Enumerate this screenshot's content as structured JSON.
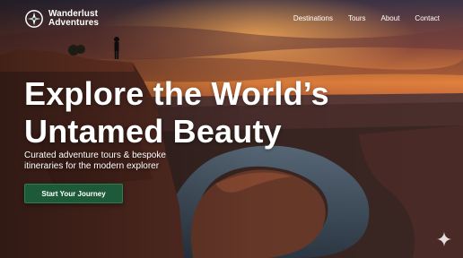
{
  "brand": {
    "line1": "Wanderlust",
    "line2": "Adventures",
    "logo_icon": "compass-icon"
  },
  "nav": {
    "items": [
      "Destinations",
      "Tours",
      "About",
      "Contact"
    ]
  },
  "hero": {
    "headline_line1": "Explore the World’s",
    "headline_line2": "Untamed Beauty",
    "subtitle": "Curated adventure tours & bespoke itineraries for the modern explorer",
    "cta_label": "Start Your Journey",
    "cta_color": "#1d5a3a",
    "background": "canyon-sunset-photo"
  },
  "corner_icon": "sparkle-icon"
}
